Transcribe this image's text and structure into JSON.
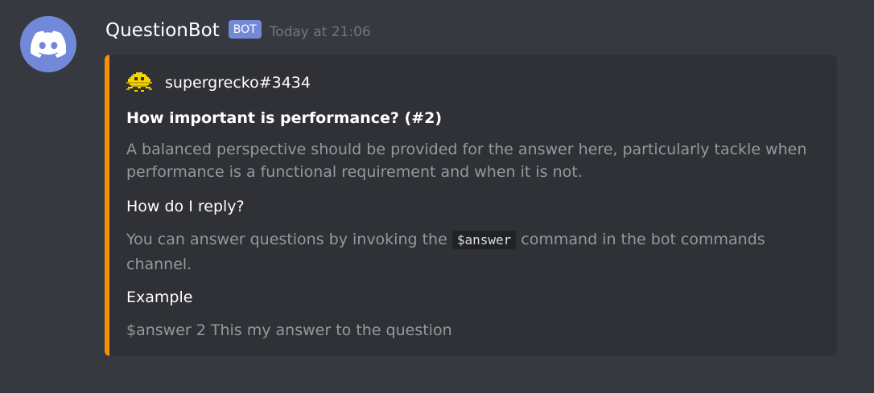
{
  "message": {
    "username": "QuestionBot",
    "bot_tag": "BOT",
    "timestamp": "Today at 21:06",
    "avatar_icon": "discord-logo-icon",
    "avatar_color": "#7289da"
  },
  "embed": {
    "accent_color": "#f4900c",
    "author": {
      "name": "supergrecko#3434",
      "icon": "pixel-avatar-icon"
    },
    "title": "How important is performance?  (#2)",
    "description": "A balanced perspective should be provided for the answer here, particularly tackle when performance is a functional requirement and when it is not.",
    "fields": [
      {
        "name": "How do I reply?",
        "value_before": "You can answer questions by invoking the ",
        "value_code": "$answer",
        "value_after": " command in the bot commands channel."
      },
      {
        "name": "Example",
        "value": "$answer 2 This my answer to the question"
      }
    ]
  }
}
